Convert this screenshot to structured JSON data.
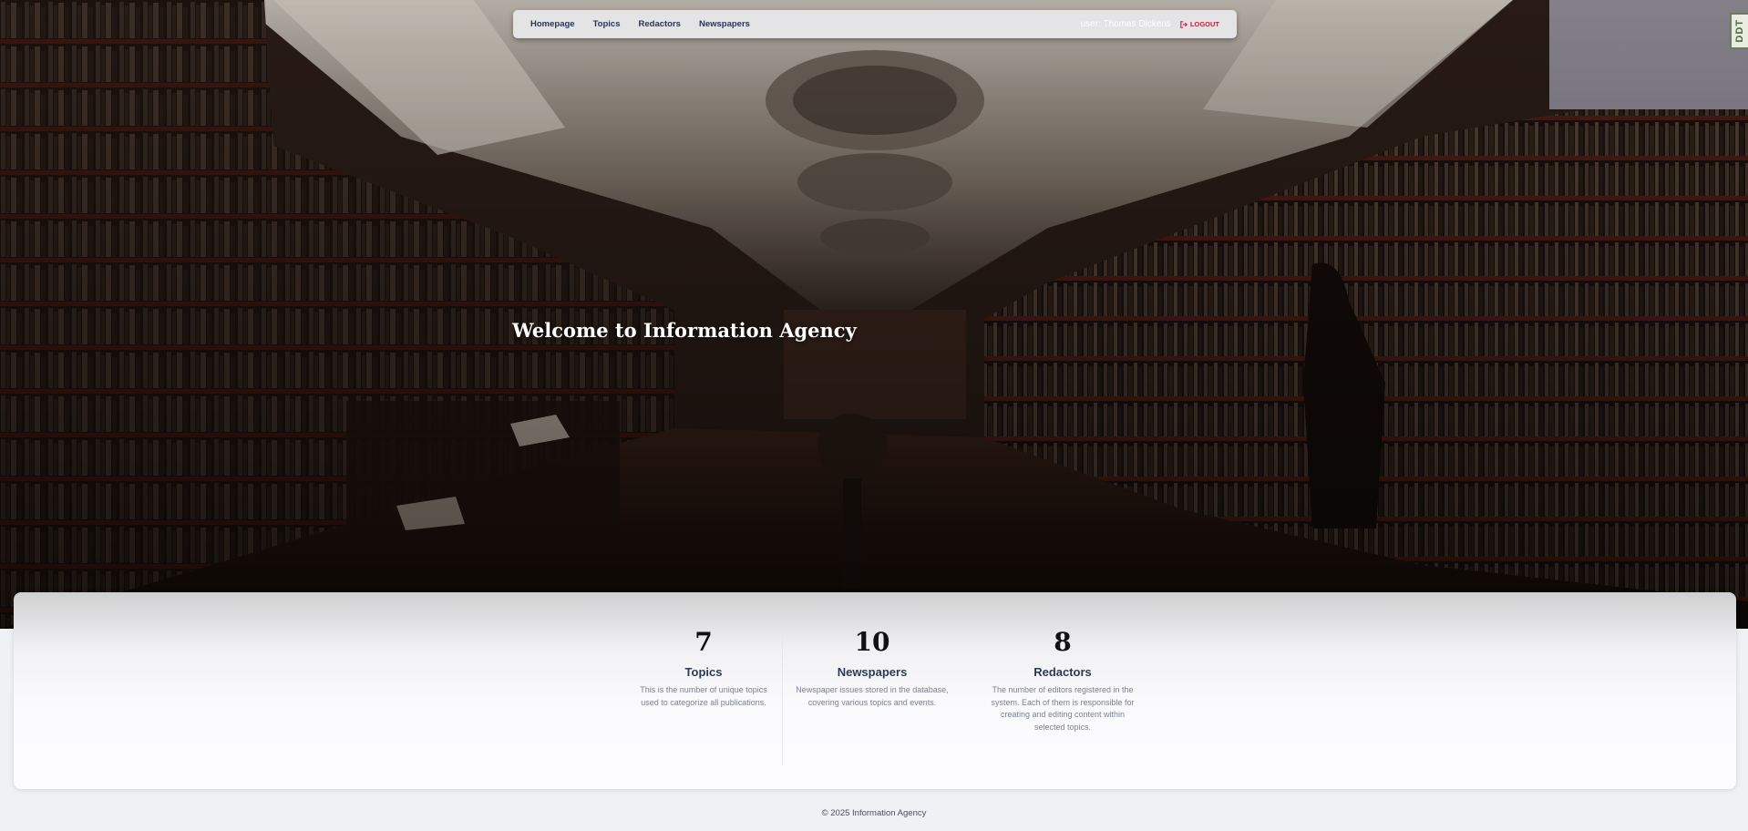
{
  "nav": {
    "links": [
      "Homepage",
      "Topics",
      "Redactors",
      "Newspapers"
    ],
    "user_label": "user: Thomas Dickens",
    "logout_label": "LOGOUT"
  },
  "hero": {
    "title": "Welcome to Information Agency",
    "background_icon": "library-interior-photo"
  },
  "corner_badge": "DDT",
  "stats": [
    {
      "number": "7",
      "title": "Topics",
      "description": "This is the number of unique topics used to categorize all publications."
    },
    {
      "number": "10",
      "title": "Newspapers",
      "description": "Newspaper issues stored in the database, covering various topics and events."
    },
    {
      "number": "8",
      "title": "Redactors",
      "description": "The number of editors registered in the system. Each of them is responsible for creating and editing content within selected topics."
    }
  ],
  "footer": "© 2025 Information Agency",
  "colors": {
    "nav_text": "#2a3550",
    "logout": "#c81e3e",
    "stat_title": "#2b3a55",
    "page_bg": "#f0f1f5"
  }
}
